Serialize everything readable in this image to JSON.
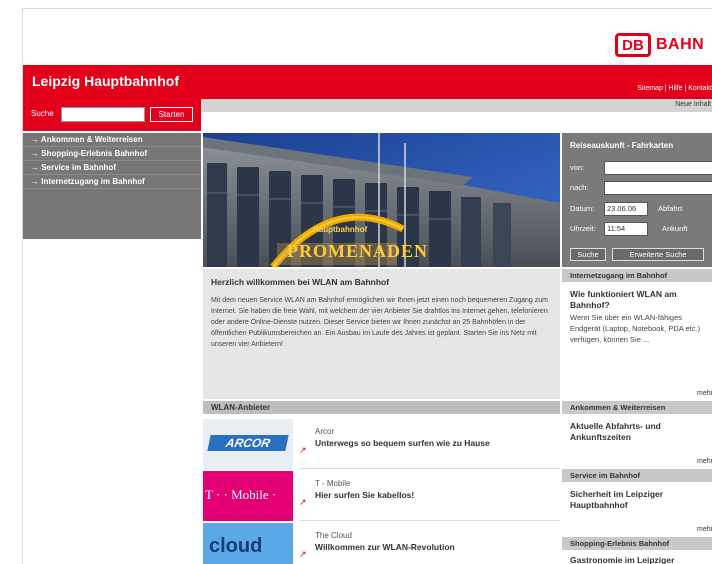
{
  "header": {
    "logo_abbr": "DB",
    "logo_word": "BAHN",
    "site_title": "Leipzig Hauptbahnhof",
    "util_links": "Sitemap | Hilfe | Kontakt",
    "subnav_text": "Neue Inhalt"
  },
  "search": {
    "label": "Suche",
    "value": "",
    "button": "Starten"
  },
  "leftnav": {
    "items": [
      {
        "label": "→ Ankommen & Weiterreisen"
      },
      {
        "label": "→ Shopping-Erlebnis Bahnhof"
      },
      {
        "label": "→ Service im Bahnhof"
      },
      {
        "label": "→ Internetzugang im Bahnhof"
      }
    ]
  },
  "hero": {
    "sign_small": "Hauptbahnhof",
    "sign_big": "PROMENADEN"
  },
  "welcome": {
    "title": "Herzlich willkommen bei WLAN am Bahnhof",
    "body": "Mit dem neuen Service WLAN am Bahnhof ermöglichen wir Ihnen jetzt einen noch bequemeren Zugang zum Internet. Sie haben die freie Wahl, mit welchem der vier Anbieter Sie drahtlos ins Internet gehen, telefonieren oder andere Online-Dienste nutzen. Dieser Service bieten wir Ihnen zunächst an 25 Bahnhöfen in der öffentlichen Publikumsbereichen an. Ein Ausbau im Laufe des Jahres ist geplant. Starten Sie ins Netz mit unseren vier Anbietern!"
  },
  "providers": {
    "heading": "WLAN-Anbieter",
    "items": [
      {
        "name": "Arcor",
        "tagline": "Unterwegs so bequem surfen wie zu Hause",
        "logo": "ARCOR"
      },
      {
        "name": "T - Mobile",
        "tagline": "Hier surfen Sie kabellos!",
        "logo": "T · · Mobile ·"
      },
      {
        "name": "The Cloud",
        "tagline": "Willkommen zur WLAN-Revolution",
        "logo": "cloud"
      }
    ]
  },
  "travel": {
    "title": "Reiseauskunft - Fahrkarten",
    "from_label": "von:",
    "to_label": "nach:",
    "date_label": "Datum:",
    "date_value": "23.06.06",
    "depart_label": "Abfahrt",
    "time_label": "Uhrzeit:",
    "time_value": "11:54",
    "arrive_label": "Ankunft",
    "search_button": "Suche",
    "advanced_button": "Erweiterte Suche"
  },
  "sidebar": {
    "internet": {
      "heading": "Internetzugang im Bahnhof",
      "title": "Wie funktioniert WLAN am Bahnhof?",
      "text": "Wenn Sie über ein WLAN-fähiges Endgerät (Laptop, Notebook, PDA etc.) verfügen, können Sie ...",
      "more": "mehr"
    },
    "arrival": {
      "heading": "Ankommen & Weiterreisen",
      "title": "Aktuelle Abfahrts- und Ankunftszeiten",
      "more": "mehr"
    },
    "service": {
      "heading": "Service im Bahnhof",
      "title": "Sicherheit im Leipziger Hauptbahnhof",
      "more": "mehr"
    },
    "shopping": {
      "heading": "Shopping-Erlebnis Bahnhof",
      "title": "Gastronomie im Leipziger"
    }
  },
  "colors": {
    "brand_red": "#e2001a",
    "nav_grey": "#777777",
    "panel_grey": "#e6e6e6",
    "tmobile_magenta": "#e20074"
  }
}
